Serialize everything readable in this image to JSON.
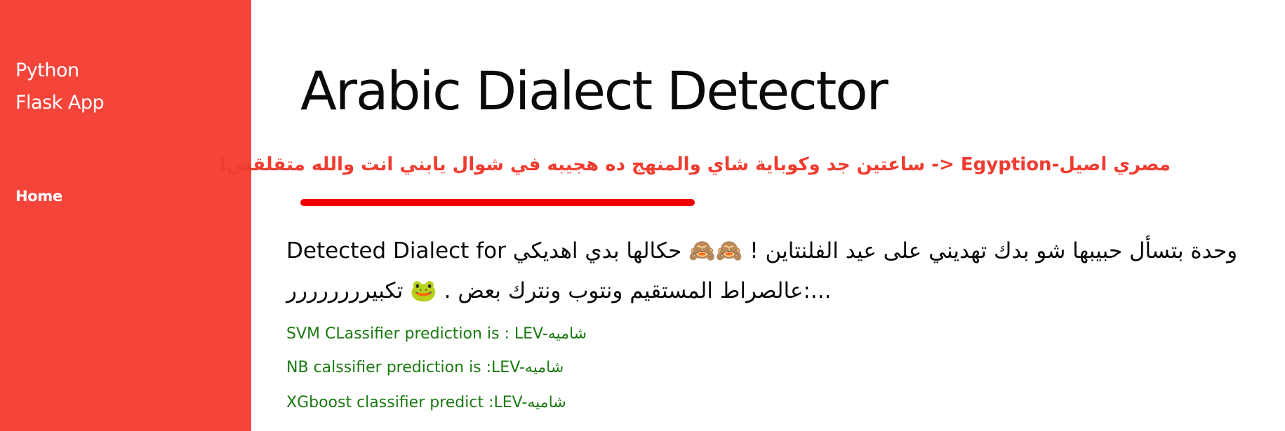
{
  "sidebar": {
    "brand_line1": "Python",
    "brand_line2": "Flask App",
    "nav_home": "Home",
    "bg_color": "#f5443a"
  },
  "main": {
    "title": "Arabic Dialect Detector",
    "example": "مصري اصيل-Egyption <- ساعتين جد وكوباية شاي والمنهج ده هجيبه في شوال يابني انت والله متقلقش!",
    "example_color": "#f03c30",
    "underline_color": "#ee0000",
    "detected_prefix": "Detected Dialect for",
    "detected_text": "وحدة بتسأل حبيبها شو بدك تهديني على عيد الفلنتاين ! 🙈🙈 حكالها بدي اهديكي عالصراط المستقيم ونتوب ونترك بعض . 🐸 تكبيرررررررر",
    "detected_suffix": ":...",
    "results": [
      "SVM CLassifier prediction is : LEV-شاميه",
      "NB calssifier prediction is :LEV-شاميه",
      "XGboost classifier predict :LEV-شاميه"
    ],
    "result_color": "#1a7a10"
  }
}
